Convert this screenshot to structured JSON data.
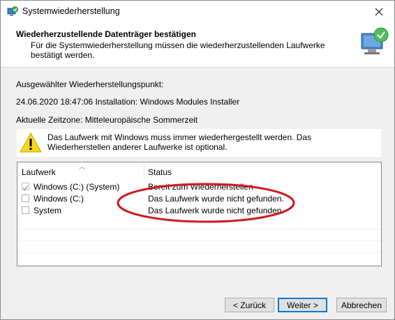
{
  "window": {
    "title": "Systemwiederherstellung",
    "close_symbol": "✕"
  },
  "header": {
    "title": "Wiederherzustellende Datenträger bestätigen",
    "subtitle": "Für die Systemwiederherstellung müssen die wiederherzustellenden Laufwerke bestätigt werden."
  },
  "restore_point": {
    "label": "Ausgewählter Wiederherstellungspunkt:",
    "value": "24.06.2020 18:47:06 Installation: Windows Modules Installer"
  },
  "timezone": "Aktuelle Zeitzone: Mitteleuropäische Sommerzeit",
  "warning": "Das Laufwerk mit Windows muss immer wiederhergestellt werden. Das Wiederherstellen anderer Laufwerke ist optional.",
  "table": {
    "columns": [
      "Laufwerk",
      "Status"
    ],
    "rows": [
      {
        "drive": "Windows (C:) (System)",
        "status": "Bereit zum Wiederherstellen",
        "checked": true
      },
      {
        "drive": "Windows (C:)",
        "status": "Das Laufwerk wurde nicht gefunden.",
        "checked": false
      },
      {
        "drive": "System",
        "status": "Das Laufwerk wurde nicht gefunden.",
        "checked": false
      }
    ]
  },
  "buttons": {
    "back": "< Zurück",
    "next": "Weiter >",
    "cancel": "Abbrechen"
  },
  "colors": {
    "annotation_red": "#d0181e",
    "primary_border": "#0078d7"
  },
  "icons": {
    "title": "system-restore-icon",
    "header": "computer-restore-icon",
    "warning": "warning-icon",
    "close": "close-icon"
  }
}
